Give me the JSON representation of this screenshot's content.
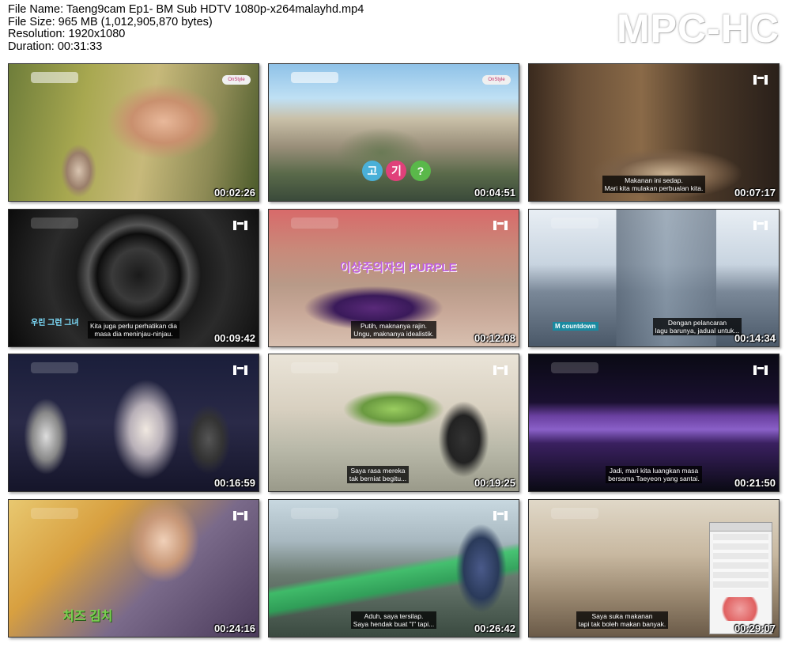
{
  "info": {
    "file_name": "File Name: Taeng9cam Ep1- BM Sub HDTV 1080p-x264malayhd.mp4",
    "file_size": "File Size: 965 MB (1,012,905,870 bytes)",
    "resolution": "Resolution: 1920x1080",
    "duration": "Duration: 00:31:33"
  },
  "brand": "MPC-HC",
  "thumbnails": [
    {
      "time": "00:02:26",
      "subtitle": ""
    },
    {
      "time": "00:04:51",
      "subtitle": ""
    },
    {
      "time": "00:07:17",
      "subtitle": "Makanan ini sedap.\nMari kita mulakan perbualan kita."
    },
    {
      "time": "00:09:42",
      "subtitle": "Kita juga perlu perhatikan dia\nmasa dia meninjau-ninjau."
    },
    {
      "time": "00:12:08",
      "subtitle": "Putih, maknanya rajin.\nUngu, maknanya idealistik."
    },
    {
      "time": "00:14:34",
      "subtitle": "Dengan pelancaran\nlagu barunya, jadual untuk..."
    },
    {
      "time": "00:16:59",
      "subtitle": ""
    },
    {
      "time": "00:19:25",
      "subtitle": "Saya rasa mereka\ntak berniat begitu..."
    },
    {
      "time": "00:21:50",
      "subtitle": "Jadi, mari kita luangkan masa\nbersama Taeyeon yang santai."
    },
    {
      "time": "00:24:16",
      "subtitle": ""
    },
    {
      "time": "00:26:42",
      "subtitle": "Aduh, saya tersilap.\nSaya hendak buat \"I\" tapi..."
    },
    {
      "time": "00:29:07",
      "subtitle": "Saya suka makanan\ntapi tak boleh makan banyak."
    }
  ],
  "overlays": {
    "purple_title": "이상주의자의 PURPLE",
    "countdown": "M countdown",
    "kimchi": "치즈 김치",
    "letters": [
      "고",
      "기",
      "?"
    ]
  },
  "colors": {
    "accent_purple": "#c060e0",
    "text_white": "#ffffff"
  }
}
